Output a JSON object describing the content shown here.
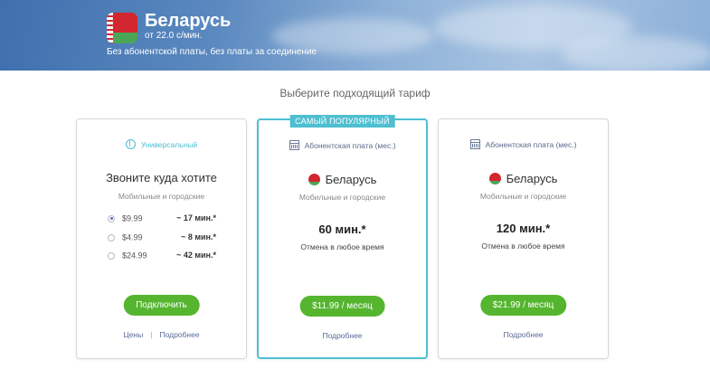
{
  "hero": {
    "country": "Беларусь",
    "rate": "от 22.0  с/мин.",
    "subtitle": "Без абонентской платы, без платы за соединение"
  },
  "section_title": "Выберите подходящий тариф",
  "cards": [
    {
      "type_label": "Универсальный",
      "title": "Звоните куда хотите",
      "subtitle": "Мобильные и городские",
      "options": [
        {
          "price": "$9.99",
          "minutes": "~ 17 мин.*",
          "selected": true
        },
        {
          "price": "$4.99",
          "minutes": "~ 8 мин.*",
          "selected": false
        },
        {
          "price": "$24.99",
          "minutes": "~ 42 мин.*",
          "selected": false
        }
      ],
      "button": "Подключить",
      "link1": "Цены",
      "link_sep": "|",
      "link2": "Подробнее"
    },
    {
      "badge": "САМЫЙ ПОПУЛЯРНЫЙ",
      "type_label": "Абонентская плата (мес.)",
      "country": "Беларусь",
      "subtitle": "Мобильные и городские",
      "minutes": "60 мин.*",
      "cancel": "Отмена в любое время",
      "button": "$11.99 / месяц",
      "link": "Подробнее"
    },
    {
      "type_label": "Абонентская плата (мес.)",
      "country": "Беларусь",
      "subtitle": "Мобильные и городские",
      "minutes": "120 мин.*",
      "cancel": "Отмена в любое время",
      "button": "$21.99 / месяц",
      "link": "Подробнее"
    }
  ],
  "colors": {
    "accent": "#4dbfd0",
    "button": "#55b52f",
    "flag_red": "#d22730",
    "flag_green": "#4aa657"
  },
  "icons": [
    "belarus-flag-icon",
    "globe-icon",
    "calendar-icon",
    "radio-icon"
  ]
}
